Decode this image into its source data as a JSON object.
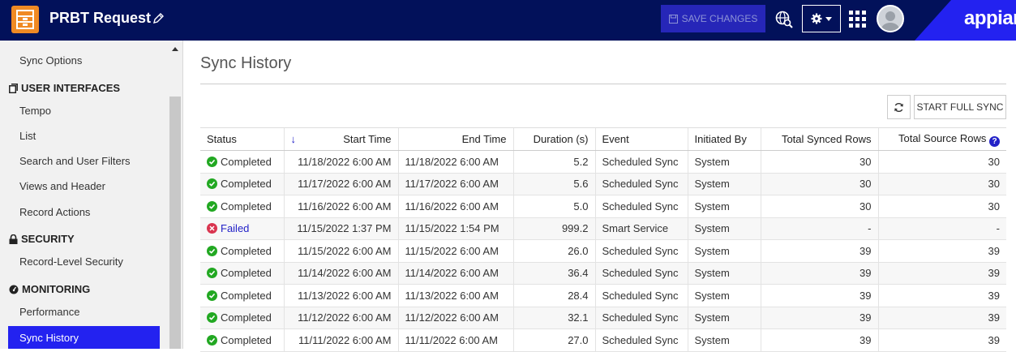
{
  "header": {
    "app_title": "PRBT Request",
    "save_label": "SAVE CHANGES",
    "brand": "appian",
    "colors": {
      "bar": "#02115a",
      "save": "#2626b8",
      "brand": "#2322f0",
      "app_icon": "#f08a24"
    }
  },
  "sidebar": {
    "items": [
      {
        "type": "item",
        "label": "Sync Options"
      },
      {
        "type": "heading",
        "label": "USER INTERFACES",
        "icon": "layers-icon"
      },
      {
        "type": "item",
        "label": "Tempo"
      },
      {
        "type": "item",
        "label": "List"
      },
      {
        "type": "item",
        "label": "Search and User Filters"
      },
      {
        "type": "item",
        "label": "Views and Header"
      },
      {
        "type": "item",
        "label": "Record Actions"
      },
      {
        "type": "heading",
        "label": "SECURITY",
        "icon": "lock-icon"
      },
      {
        "type": "item",
        "label": "Record-Level Security"
      },
      {
        "type": "heading",
        "label": "MONITORING",
        "icon": "dashboard-icon"
      },
      {
        "type": "item",
        "label": "Performance"
      },
      {
        "type": "item",
        "label": "Sync History",
        "active": true
      }
    ]
  },
  "main": {
    "title": "Sync History",
    "full_sync_label": "START FULL SYNC",
    "table": {
      "columns": [
        "Status",
        "Start Time",
        "End Time",
        "Duration (s)",
        "Event",
        "Initiated By",
        "Total Synced Rows",
        "Total Source Rows"
      ],
      "sort_column": "Start Time",
      "rows": [
        [
          "Completed",
          "11/18/2022 6:00 AM",
          "11/18/2022 6:00 AM",
          "5.2",
          "Scheduled Sync",
          "System",
          "30",
          "30"
        ],
        [
          "Completed",
          "11/17/2022 6:00 AM",
          "11/17/2022 6:00 AM",
          "5.6",
          "Scheduled Sync",
          "System",
          "30",
          "30"
        ],
        [
          "Completed",
          "11/16/2022 6:00 AM",
          "11/16/2022 6:00 AM",
          "5.0",
          "Scheduled Sync",
          "System",
          "30",
          "30"
        ],
        [
          "Failed",
          "11/15/2022 1:37 PM",
          "11/15/2022 1:54 PM",
          "999.2",
          "Smart Service",
          "System",
          "-",
          "-"
        ],
        [
          "Completed",
          "11/15/2022 6:00 AM",
          "11/15/2022 6:00 AM",
          "26.0",
          "Scheduled Sync",
          "System",
          "39",
          "39"
        ],
        [
          "Completed",
          "11/14/2022 6:00 AM",
          "11/14/2022 6:00 AM",
          "36.4",
          "Scheduled Sync",
          "System",
          "39",
          "39"
        ],
        [
          "Completed",
          "11/13/2022 6:00 AM",
          "11/13/2022 6:00 AM",
          "28.4",
          "Scheduled Sync",
          "System",
          "39",
          "39"
        ],
        [
          "Completed",
          "11/12/2022 6:00 AM",
          "11/12/2022 6:00 AM",
          "32.1",
          "Scheduled Sync",
          "System",
          "39",
          "39"
        ],
        [
          "Completed",
          "11/11/2022 6:00 AM",
          "11/11/2022 6:00 AM",
          "27.0",
          "Scheduled Sync",
          "System",
          "39",
          "39"
        ]
      ]
    }
  }
}
